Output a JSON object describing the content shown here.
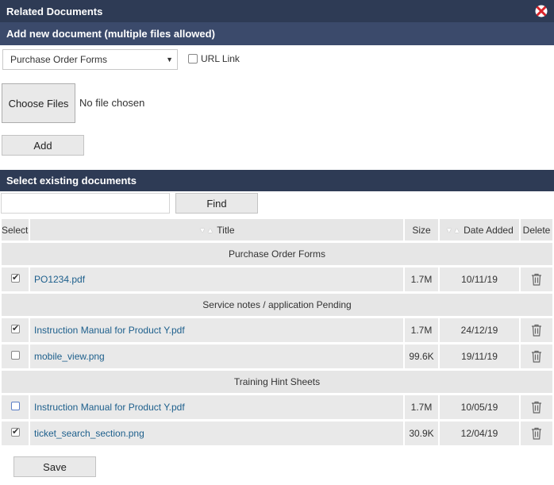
{
  "header": {
    "title": "Related Documents",
    "add_section_title": "Add new document (multiple files allowed)",
    "select_section_title": "Select existing documents"
  },
  "add_form": {
    "category_selected": "Purchase Order Forms",
    "url_link_label": "URL Link",
    "choose_files_label": "Choose Files",
    "no_file_text": "No file chosen",
    "add_button_label": "Add"
  },
  "search": {
    "value": "",
    "find_button_label": "Find"
  },
  "table": {
    "columns": {
      "select": "Select",
      "title": "Title",
      "size": "Size",
      "date_added": "Date Added",
      "delete": "Delete"
    },
    "groups": [
      {
        "name": "Purchase Order Forms",
        "rows": [
          {
            "title": "PO1234.pdf",
            "size": "1.7M",
            "date": "10/11/19",
            "checked": true
          }
        ]
      },
      {
        "name": "Service notes / application Pending",
        "rows": [
          {
            "title": "Instruction Manual for Product Y.pdf",
            "size": "1.7M",
            "date": "24/12/19",
            "checked": true
          },
          {
            "title": "mobile_view.png",
            "size": "99.6K",
            "date": "19/11/19",
            "checked": false
          }
        ]
      },
      {
        "name": "Training Hint Sheets",
        "rows": [
          {
            "title": "Instruction Manual for Product Y.pdf",
            "size": "1.7M",
            "date": "10/05/19",
            "checked": false
          },
          {
            "title": "ticket_search_section.png",
            "size": "30.9K",
            "date": "12/04/19",
            "checked": true
          }
        ]
      }
    ]
  },
  "footer": {
    "save_button_label": "Save"
  },
  "colors": {
    "header_dark": "#2e3b55",
    "header_mid": "#3b4a6b",
    "link": "#1d5f8c",
    "close_red": "#d9242a"
  }
}
